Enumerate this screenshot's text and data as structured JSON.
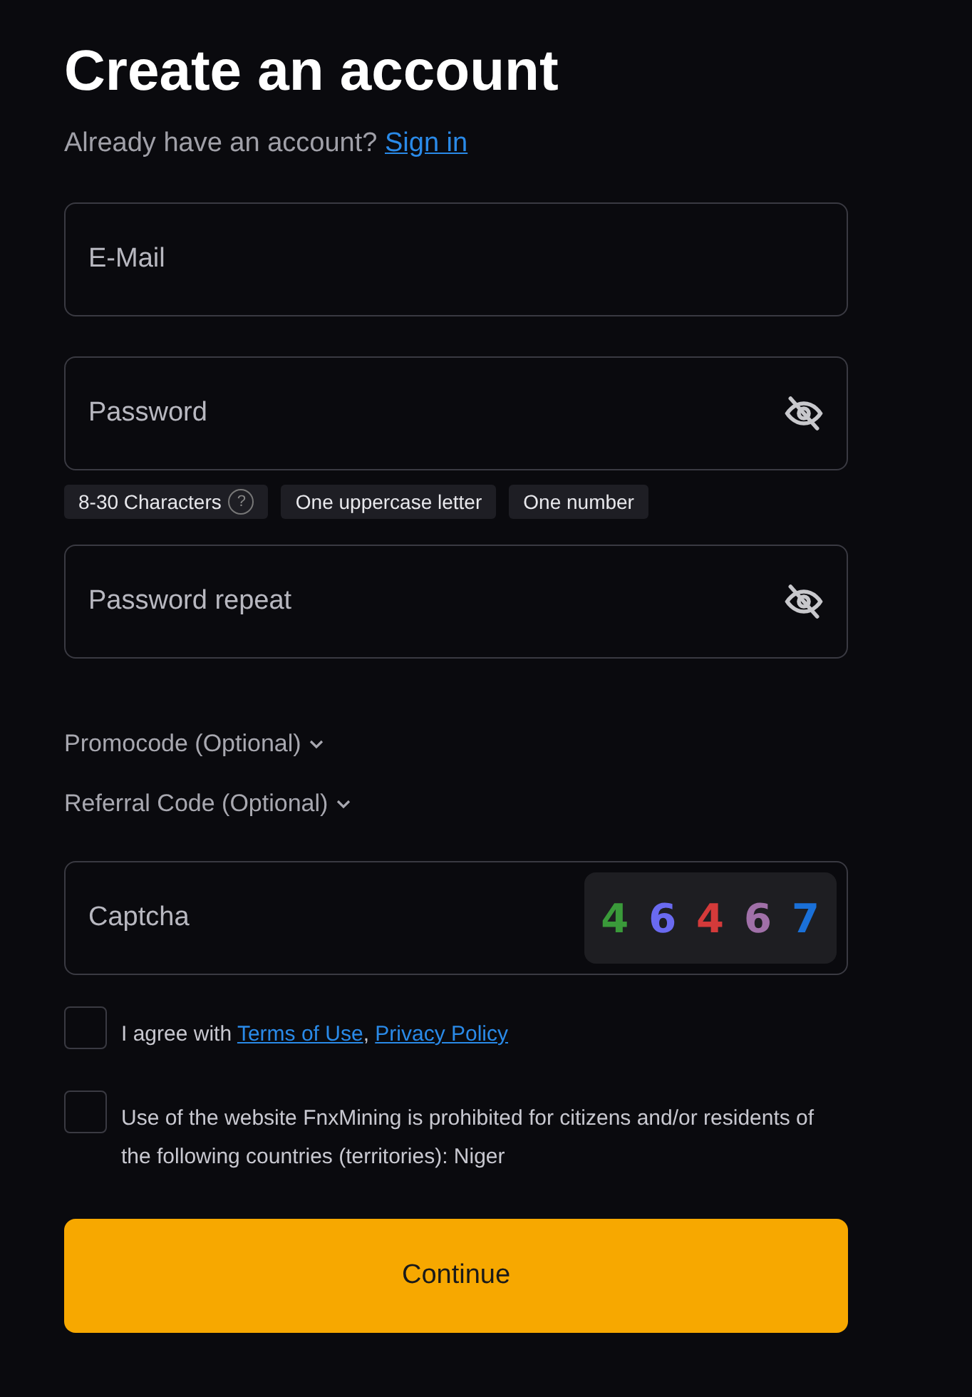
{
  "title": "Create an account",
  "signin": {
    "text": "Already have an account?",
    "link": "Sign in"
  },
  "fields": [
    {
      "kind": "text",
      "placeholder": "E-Mail"
    },
    {
      "kind": "password",
      "placeholder": "Password",
      "hints": [
        {
          "label": "8-30 Characters",
          "help": "?"
        },
        {
          "label": "One uppercase letter"
        },
        {
          "label": "One number"
        }
      ]
    },
    {
      "kind": "password",
      "placeholder": "Password repeat"
    }
  ],
  "optional": [
    {
      "label": "Promocode (Optional)",
      "expanded": false
    },
    {
      "label": "Referral Code (Optional)",
      "expanded": false
    }
  ],
  "captcha": {
    "placeholder": "Captcha",
    "digits": [
      {
        "text": "4",
        "color": "#3a9a3a"
      },
      {
        "text": "6",
        "color": "#6a6af0"
      },
      {
        "text": "4",
        "color": "#d43a3a"
      },
      {
        "text": "6",
        "color": "#a070a8"
      },
      {
        "text": "7",
        "color": "#1a70d8"
      }
    ]
  },
  "agreements": [
    {
      "checked": false,
      "text": "I agree with ",
      "links": [
        "Terms of Use",
        "Privacy Policy"
      ],
      "separator": ", "
    },
    {
      "checked": false,
      "text": "Use of the website FnxMining is prohibited for citizens and/or residents of the following countries (territories): Niger"
    }
  ],
  "button": "Continue"
}
